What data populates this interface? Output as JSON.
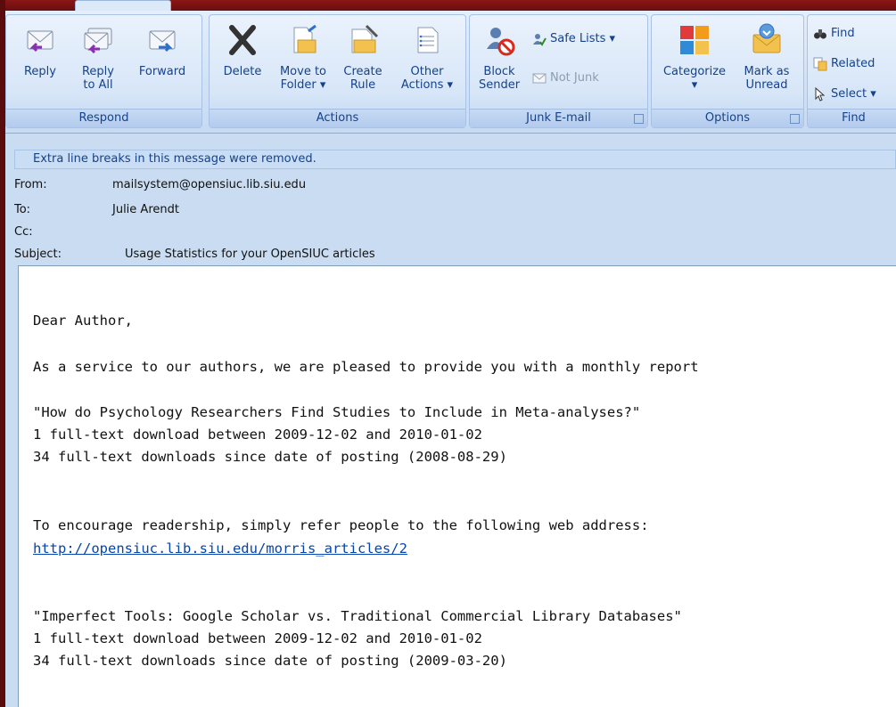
{
  "ribbon": {
    "respond": {
      "label": "Respond",
      "reply": "Reply",
      "reply_all": "Reply\nto All",
      "forward": "Forward"
    },
    "actions": {
      "label": "Actions",
      "delete": "Delete",
      "move": "Move to\nFolder ▾",
      "create_rule": "Create\nRule",
      "other": "Other\nActions ▾"
    },
    "junk": {
      "label": "Junk E-mail",
      "block": "Block\nSender",
      "safe_lists": "Safe Lists ▾",
      "not_junk": "Not Junk"
    },
    "options": {
      "label": "Options",
      "categorize": "Categorize\n▾",
      "mark_unread": "Mark as\nUnread"
    },
    "find": {
      "label": "Find",
      "find": "Find",
      "related": "Related",
      "select": "Select ▾"
    }
  },
  "infobar": "Extra line breaks in this message were removed.",
  "header": {
    "from_label": "From:",
    "from": "mailsystem@opensiuc.lib.siu.edu",
    "to_label": "To:",
    "to": "Julie Arendt",
    "cc_label": "Cc:",
    "cc": "",
    "subject_label": "Subject:",
    "subject": "Usage Statistics for your OpenSIUC articles"
  },
  "message": {
    "greeting": "Dear Author,",
    "intro": "As a service to our authors, we are pleased to provide you with a monthly report",
    "article1_title": "\"How do Psychology Researchers Find Studies to Include in Meta-analyses?\"",
    "article1_line1": "1 full-text download between 2009-12-02 and 2010-01-02",
    "article1_line2": "34 full-text downloads since date of posting (2008-08-29)",
    "encourage": "To encourage readership, simply refer people to the following web address:",
    "link1": "http://opensiuc.lib.siu.edu/morris_articles/2",
    "article2_title": "\"Imperfect Tools: Google Scholar vs. Traditional Commercial Library Databases\"",
    "article2_line1": "1 full-text download between 2009-12-02 and 2010-01-02",
    "article2_line2": "34 full-text downloads since date of posting (2009-03-20)"
  }
}
